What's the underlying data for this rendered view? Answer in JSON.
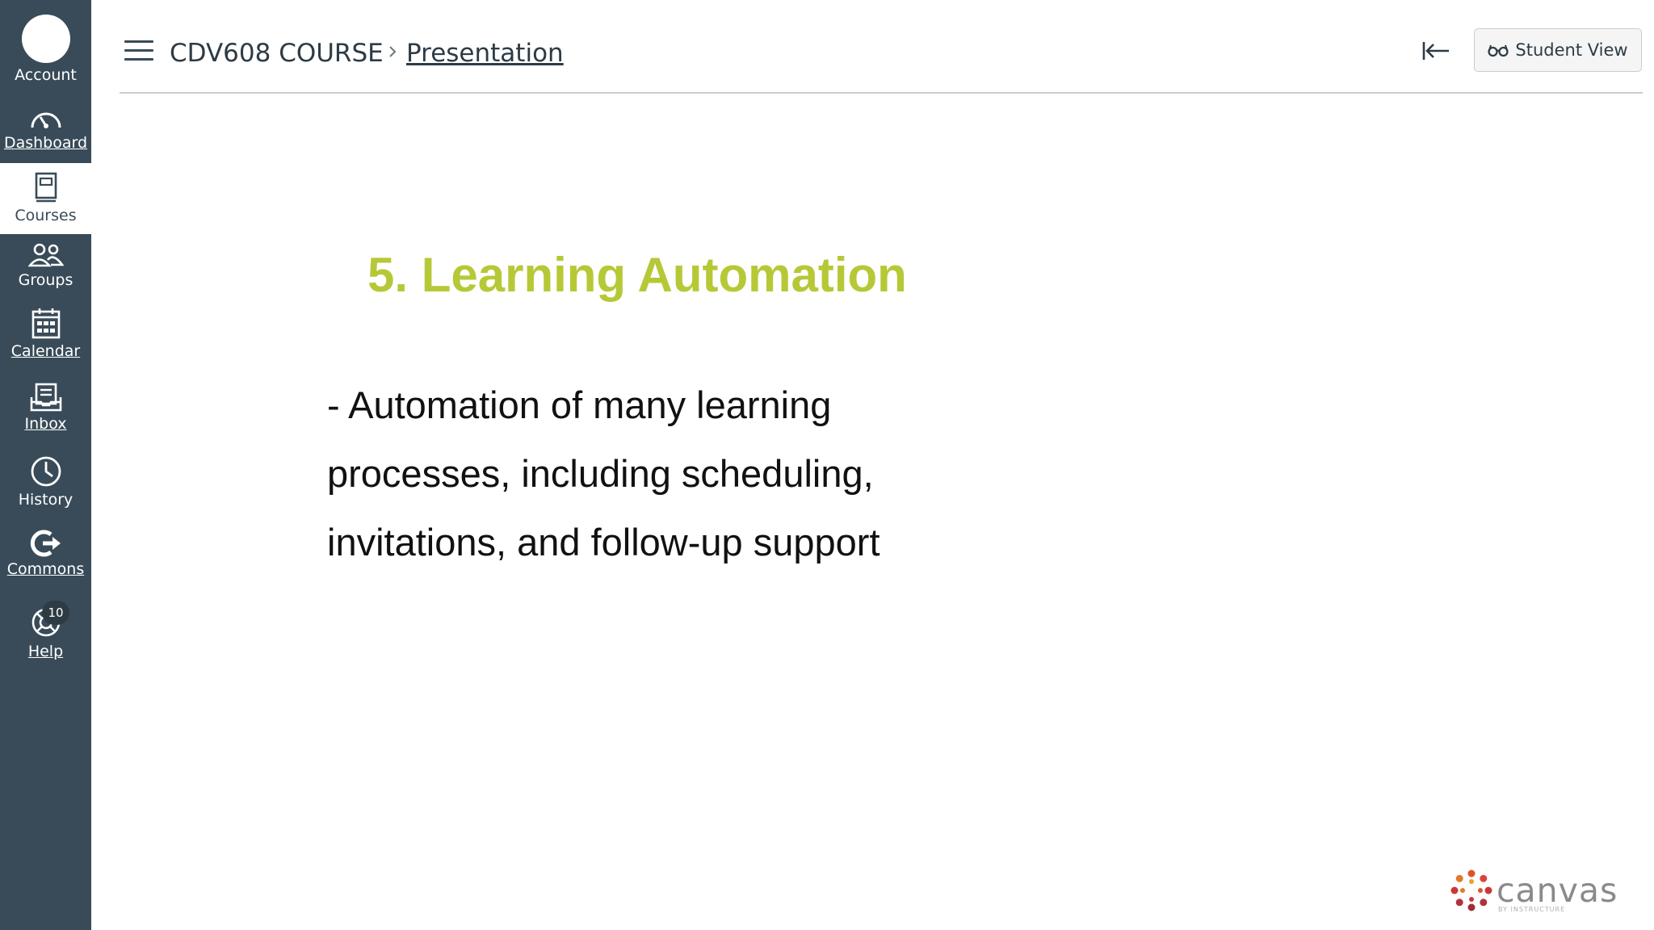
{
  "nav": {
    "items": [
      {
        "label": "Account",
        "icon": "avatar"
      },
      {
        "label": "Dashboard",
        "icon": "dashboard-icon"
      },
      {
        "label": "Courses",
        "icon": "courses-icon"
      },
      {
        "label": "Groups",
        "icon": "groups-icon"
      },
      {
        "label": "Calendar",
        "icon": "calendar-icon"
      },
      {
        "label": "Inbox",
        "icon": "inbox-icon"
      },
      {
        "label": "History",
        "icon": "history-icon"
      },
      {
        "label": "Commons",
        "icon": "commons-icon"
      },
      {
        "label": "Help",
        "icon": "help-icon",
        "badge": "10"
      }
    ],
    "active": "Courses",
    "bg_color": "#394b58"
  },
  "header": {
    "course": "CDV608 COURSE",
    "current_page": "Presentation",
    "student_view_label": "Student View"
  },
  "slide": {
    "title": "5. Learning Automation",
    "title_color": "#b7c837",
    "lines": [
      "- Automation of many learning",
      "processes, including scheduling,",
      "invitations, and follow-up support"
    ]
  },
  "logo": {
    "word": "canvas",
    "sub": "BY INSTRUCTURE"
  }
}
